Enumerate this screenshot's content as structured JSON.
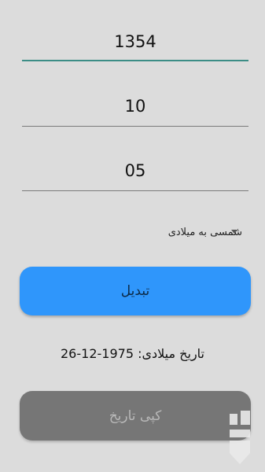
{
  "form": {
    "year": "1354",
    "month": "10",
    "day": "05",
    "conversion_type": "شمسی به میلادی"
  },
  "buttons": {
    "convert_label": "تبدیل",
    "copy_label": "کپی تاریخ"
  },
  "result": {
    "text": "تاریخ میلادی: 1975-12-26"
  },
  "colors": {
    "accent": "#3c8d86",
    "convert_button": "#2f96fb",
    "copy_button": "#767676",
    "background": "#dcdcdc"
  },
  "icons": {
    "dropdown": "chevron-down-icon",
    "watermark": "bazaar-logo-icon"
  }
}
